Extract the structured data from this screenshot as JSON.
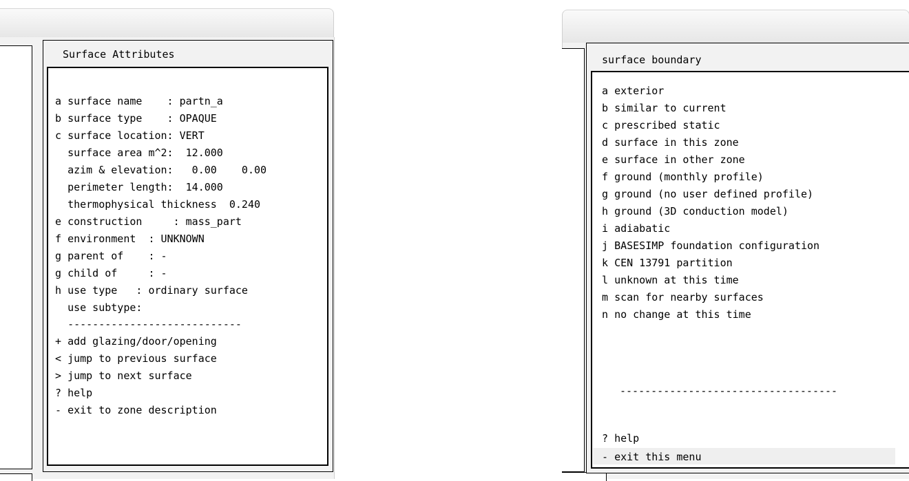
{
  "left_window": {
    "title": "Surface Attributes",
    "items": [
      {
        "key": "a",
        "text": "surface name    : partn_a"
      },
      {
        "key": "b",
        "text": "surface type    : OPAQUE"
      },
      {
        "key": "c",
        "text": "surface location: VERT"
      },
      {
        "key": " ",
        "text": "surface area m^2:  12.000"
      },
      {
        "key": " ",
        "text": "azim & elevation:   0.00    0.00"
      },
      {
        "key": " ",
        "text": "perimeter length:  14.000"
      },
      {
        "key": " ",
        "text": "thermophysical thickness  0.240"
      },
      {
        "key": "e",
        "text": "construction     : mass_part"
      },
      {
        "key": "f",
        "text": "environment  : UNKNOWN"
      },
      {
        "key": "g",
        "text": "parent of    : -"
      },
      {
        "key": "g",
        "text": "child of     : -"
      },
      {
        "key": "h",
        "text": "use type   : ordinary surface"
      },
      {
        "key": " ",
        "text": "use subtype:"
      },
      {
        "key": " ",
        "text": "----------------------------"
      },
      {
        "key": "+",
        "text": "add glazing/door/opening"
      },
      {
        "key": "<",
        "text": "jump to previous surface"
      },
      {
        "key": ">",
        "text": "jump to next surface"
      },
      {
        "key": "?",
        "text": "help"
      },
      {
        "key": "-",
        "text": "exit to zone description"
      }
    ]
  },
  "right_window": {
    "title": "surface boundary",
    "items": [
      {
        "key": "a",
        "text": "exterior"
      },
      {
        "key": "b",
        "text": "similar to current"
      },
      {
        "key": "c",
        "text": "prescribed static"
      },
      {
        "key": "d",
        "text": "surface in this zone"
      },
      {
        "key": "e",
        "text": "surface in other zone"
      },
      {
        "key": "f",
        "text": "ground (monthly profile)"
      },
      {
        "key": "g",
        "text": "ground (no user defined profile)"
      },
      {
        "key": "h",
        "text": "ground (3D conduction model)"
      },
      {
        "key": "i",
        "text": "adiabatic"
      },
      {
        "key": "j",
        "text": "BASESIMP foundation configuration"
      },
      {
        "key": "k",
        "text": "CEN 13791 partition"
      },
      {
        "key": "l",
        "text": "unknown at this time"
      },
      {
        "key": "m",
        "text": "scan for nearby surfaces"
      },
      {
        "key": "n",
        "text": "no change at this time"
      }
    ],
    "separator": "-----------------------------------",
    "footer": [
      {
        "key": "?",
        "text": "help"
      },
      {
        "key": "-",
        "text": "exit this menu"
      }
    ]
  }
}
